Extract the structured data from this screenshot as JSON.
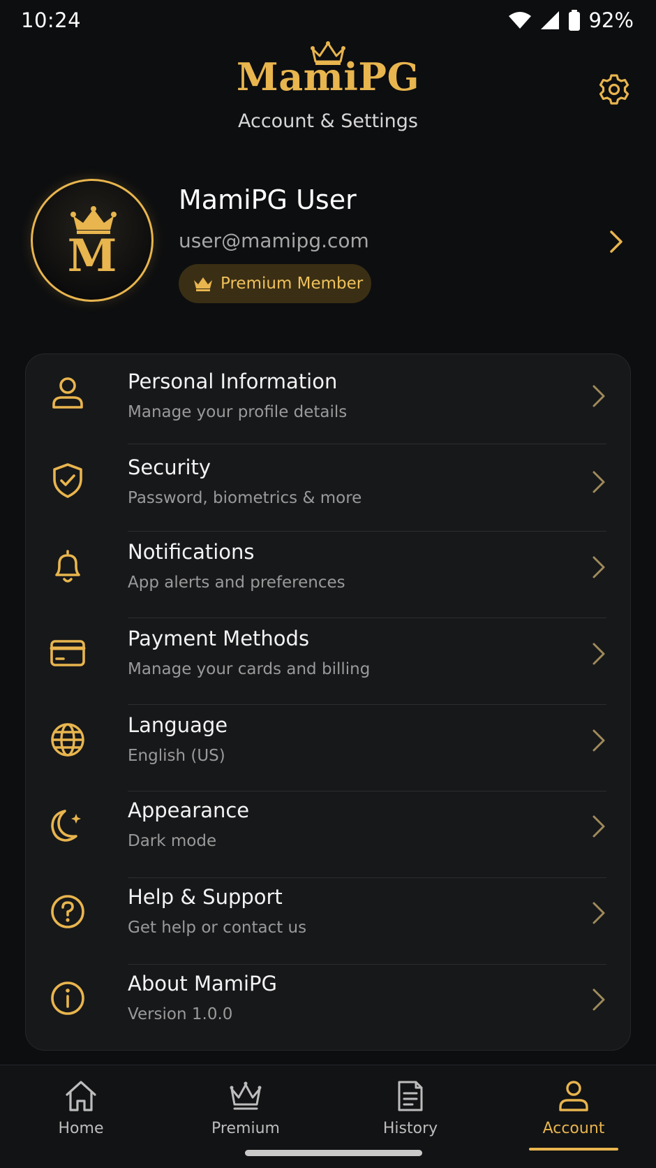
{
  "status_bar": {
    "time": "10:24",
    "battery": "92%"
  },
  "header": {
    "logo": "MamiPG",
    "subtitle": "Account & Settings"
  },
  "profile": {
    "avatar_letter": "M",
    "name": "MamiPG User",
    "email": "user@mamipg.com",
    "badge": "Premium Member"
  },
  "settings": [
    {
      "icon": "user-icon",
      "title": "Personal Information",
      "subtitle": "Manage your profile details"
    },
    {
      "icon": "shield-check-icon",
      "title": "Security",
      "subtitle": "Password, biometrics & more"
    },
    {
      "icon": "bell-icon",
      "title": "Notifications",
      "subtitle": "App alerts and preferences"
    },
    {
      "icon": "credit-card-icon",
      "title": "Payment Methods",
      "subtitle": "Manage your cards and billing"
    },
    {
      "icon": "globe-icon",
      "title": "Language",
      "subtitle": "English (US)"
    },
    {
      "icon": "moon-icon",
      "title": "Appearance",
      "subtitle": "Dark mode"
    },
    {
      "icon": "help-circle-icon",
      "title": "Help & Support",
      "subtitle": "Get help or contact us"
    },
    {
      "icon": "info-icon",
      "title": "About MamiPG",
      "subtitle": "Version 1.0.0"
    }
  ],
  "bottom_nav": [
    {
      "icon": "home-icon",
      "label": "Home"
    },
    {
      "icon": "crown-icon",
      "label": "Premium"
    },
    {
      "icon": "document-icon",
      "label": "History"
    },
    {
      "icon": "user-icon",
      "label": "Account",
      "active": true
    }
  ],
  "colors": {
    "background": "#0d0e10",
    "card": "#17181a",
    "accent": "#e8b54e",
    "badge_bg": "#3a2f14"
  }
}
